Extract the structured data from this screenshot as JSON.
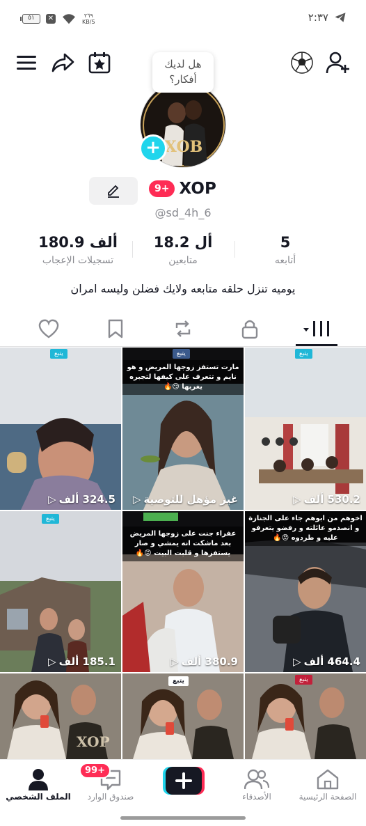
{
  "status_bar": {
    "battery": "٥١",
    "network_speed_value": "٢٦٩",
    "network_speed_unit": "KB/S",
    "time": "٢:٣٧"
  },
  "header": {
    "bubble_line1": "هل لديك",
    "bubble_line2": "أفكار؟",
    "avatar_text": "XOB"
  },
  "profile": {
    "display_name": "XOP",
    "notifications_badge": "9+",
    "handle": "@sd_4h_6",
    "bio": "يوميه تنزل حلقه متابعه ولايك فضلن وليسه امران"
  },
  "stats": [
    {
      "value": "180.9 ألف",
      "label": "تسجيلات الإعجاب"
    },
    {
      "value": "18.2 أل",
      "label": "متابعين"
    },
    {
      "value": "5",
      "label": "أتابعه"
    }
  ],
  "videos": [
    {
      "caption": "324.5 ألف",
      "tag": "يتبع",
      "overlay": ""
    },
    {
      "caption": "غير مؤهل للتوصية",
      "tag": "يتبع",
      "overlay": "مارت تستفز زوجها المريض و هو نايم و تتعرف على كيفها لتجبره يغربها 😏🔥"
    },
    {
      "caption": "530.2 ألف",
      "tag": "يتبع",
      "overlay": ""
    },
    {
      "caption": "185.1 ألف",
      "tag": "يتبع",
      "overlay": ""
    },
    {
      "caption": "380.9 ألف",
      "tag": "",
      "overlay": "عفراء جنت على زوجها المريض بعد ماشكت انه يمشي و صار يستفزها و قلبت البيت 😡🔥"
    },
    {
      "caption": "464.4 ألف",
      "tag": "",
      "overlay": "اخوهم من ابوهم جاء على الجنازة و انصدمو عائلته و رفضو يتعرفو عليه و طردوه 😡🔥"
    },
    {
      "caption": "",
      "tag": "",
      "overlay": ""
    },
    {
      "caption": "",
      "tag": "يتبع",
      "overlay": ""
    },
    {
      "caption": "",
      "tag": "يتبع",
      "overlay": ""
    }
  ],
  "bottom_nav": {
    "profile": "الملف الشخصي",
    "inbox": "صندوق الوارد",
    "inbox_badge": "99+",
    "friends": "الأصدقاء",
    "home": "الصفحة الرئيسية"
  },
  "colors": {
    "accent": "#fe2c55",
    "cyan": "#20d5ec",
    "text": "#161823",
    "muted": "#8a8b91"
  }
}
